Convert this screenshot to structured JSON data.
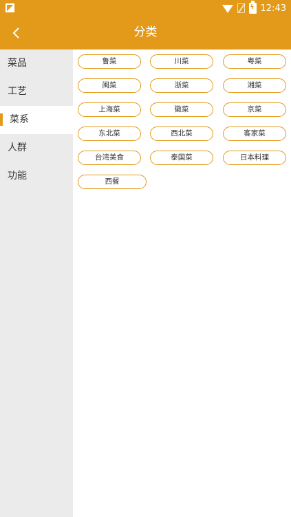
{
  "status_bar": {
    "time": "12:43"
  },
  "header": {
    "title": "分类"
  },
  "sidebar": {
    "items": [
      {
        "label": "菜品"
      },
      {
        "label": "工艺"
      },
      {
        "label": "菜系"
      },
      {
        "label": "人群"
      },
      {
        "label": "功能"
      }
    ],
    "active_index": 2
  },
  "tags": [
    "鲁菜",
    "川菜",
    "粤菜",
    "闽菜",
    "浙菜",
    "湘菜",
    "上海菜",
    "徽菜",
    "京菜",
    "东北菜",
    "西北菜",
    "客家菜",
    "台湾美食",
    "泰国菜",
    "日本料理",
    "西餐"
  ],
  "colors": {
    "accent": "#e39a1a",
    "sidebar_bg": "#ebebeb"
  }
}
